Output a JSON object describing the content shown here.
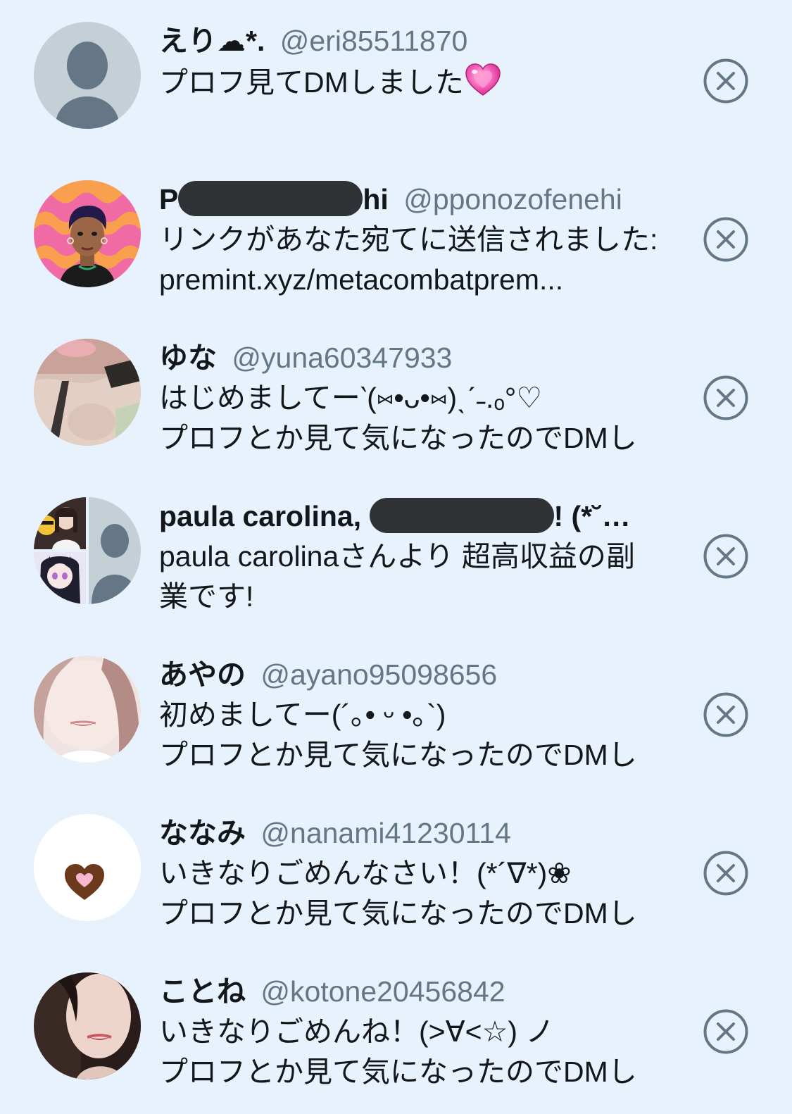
{
  "requests": [
    {
      "name": "えり☁*.",
      "handle": "@eri85511870",
      "lines": [
        "プロフ見てDMしました"
      ],
      "emoji": "heart-emoji",
      "avatar": "default-avatar"
    },
    {
      "name_prefix": "P",
      "name_suffix": "hi",
      "name_redacted": true,
      "handle": "@pponozofenehi",
      "lines": [
        "リンクがあなた宛てに送信されました:",
        "premint.xyz/metacombatprem..."
      ],
      "avatar": "illustrated-avatar"
    },
    {
      "name": "ゆな",
      "handle": "@yuna60347933",
      "lines": [
        "はじめましてー‵(⑅•ᴗ•⑅)ˎˊ˗.ₒ°♡",
        "プロフとか見て気になったのでDMし"
      ],
      "avatar": "photo-avatar"
    },
    {
      "name_prefix": "paula carolina, ",
      "name_suffix": "! (*˘…",
      "name_redacted": true,
      "lines": [
        "paula carolinaさんより 超高収益の副",
        "業です!"
      ],
      "avatar": "group-avatar"
    },
    {
      "name": "あやの",
      "handle": "@ayano95098656",
      "lines": [
        "初めましてー(´｡• ᵕ •｡`)",
        "プロフとか見て気になったのでDMし"
      ],
      "avatar": "photo-avatar"
    },
    {
      "name": "ななみ",
      "handle": "@nanami41230114",
      "lines": [
        "いきなりごめんなさい！(*´∇*)❀",
        "プロフとか見て気になったのでDMし"
      ],
      "avatar": "heart-avatar"
    },
    {
      "name": "ことね",
      "handle": "@kotone20456842",
      "lines": [
        "いきなりごめんね！(>∀<☆) ノ",
        "プロフとか見て気になったのでDMし"
      ],
      "avatar": "photo-avatar"
    }
  ],
  "colors": {
    "background": "#e7f2fd",
    "name": "#14171a",
    "handle": "#657786",
    "dismiss_icon": "#657786",
    "redaction": "#2f3336"
  },
  "icons": {
    "dismiss": "close-circle-icon"
  }
}
